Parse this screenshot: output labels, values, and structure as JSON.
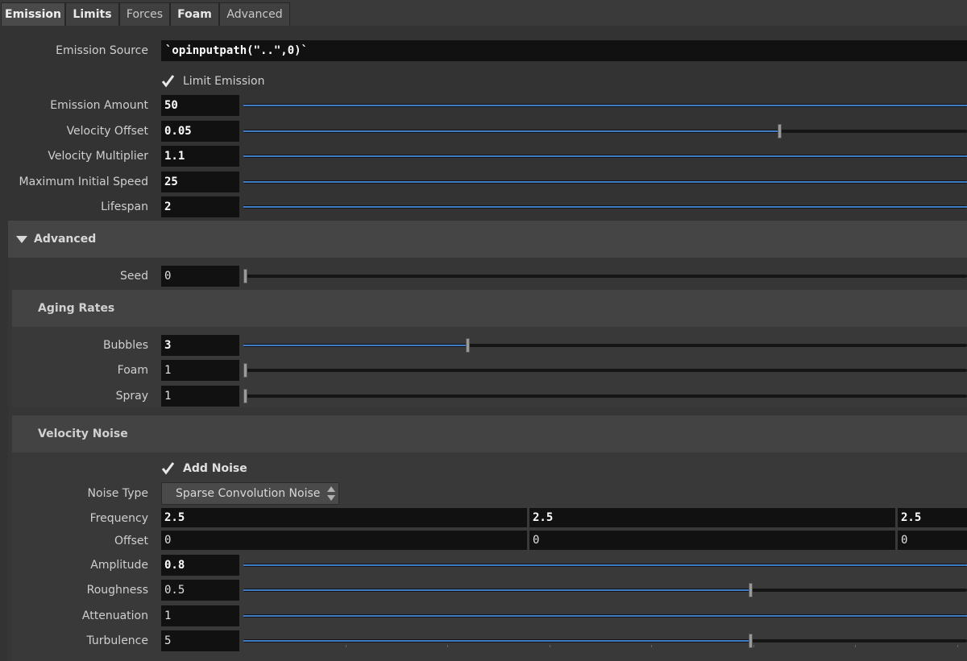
{
  "tabs": [
    {
      "label": "Emission",
      "active": true,
      "bold": true
    },
    {
      "label": "Limits",
      "active": false,
      "bold": true
    },
    {
      "label": "Forces",
      "active": false,
      "bold": false
    },
    {
      "label": "Foam",
      "active": false,
      "bold": true
    },
    {
      "label": "Advanced",
      "active": false,
      "bold": false
    }
  ],
  "emission": {
    "source_label": "Emission Source",
    "source_value": "`opinputpath(\"..\",0)`",
    "limit_emission_label": "Limit Emission",
    "limit_emission_checked": true,
    "params": [
      {
        "label": "Emission Amount",
        "value": "50",
        "fraction": 1.0
      },
      {
        "label": "Velocity Offset",
        "value": "0.05",
        "fraction": 0.74
      },
      {
        "label": "Velocity Multiplier",
        "value": "1.1",
        "fraction": 1.0
      },
      {
        "label": "Maximum Initial Speed",
        "value": "25",
        "fraction": 1.0
      },
      {
        "label": "Lifespan",
        "value": "2",
        "fraction": 1.0
      }
    ]
  },
  "advanced": {
    "title": "Advanced",
    "seed": {
      "label": "Seed",
      "value": "0",
      "fraction": 0.0
    },
    "aging": {
      "title": "Aging Rates",
      "params": [
        {
          "label": "Bubbles",
          "value": "3",
          "fraction": 0.31
        },
        {
          "label": "Foam",
          "value": "1",
          "fraction": 0.0
        },
        {
          "label": "Spray",
          "value": "1",
          "fraction": 0.0
        }
      ]
    },
    "noise": {
      "title": "Velocity Noise",
      "add_noise_label": "Add Noise",
      "add_noise_checked": true,
      "noise_type_label": "Noise Type",
      "noise_type_value": "Sparse Convolution Noise",
      "frequency_label": "Frequency",
      "frequency": [
        "2.5",
        "2.5",
        "2.5"
      ],
      "offset_label": "Offset",
      "offset": [
        "0",
        "0",
        "0"
      ],
      "params": [
        {
          "label": "Amplitude",
          "value": "0.8",
          "fraction": 1.0
        },
        {
          "label": "Roughness",
          "value": "0.5",
          "fraction": 0.7
        },
        {
          "label": "Attenuation",
          "value": "1",
          "fraction": 1.0
        },
        {
          "label": "Turbulence",
          "value": "5",
          "fraction": 0.7
        }
      ]
    }
  },
  "colors": {
    "slider_fill": "#3f7ec4",
    "panel_bg": "#333333",
    "field_bg": "#111111"
  }
}
